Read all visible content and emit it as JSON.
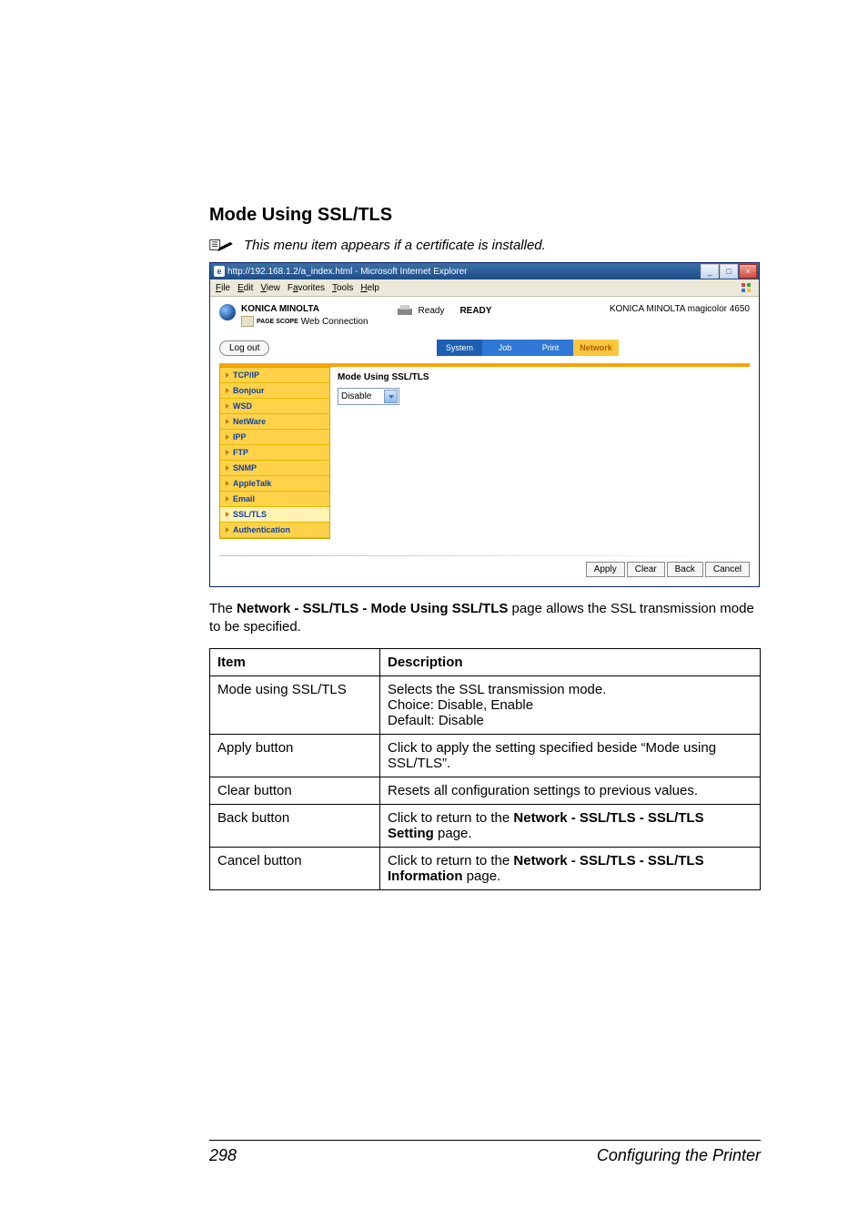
{
  "section_title": "Mode Using SSL/TLS",
  "note_text": "This menu item appears if a certificate is installed.",
  "screenshot": {
    "window_title": "http://192.168.1.2/a_index.html - Microsoft Internet Explorer",
    "menu": {
      "file": "File",
      "edit": "Edit",
      "view": "View",
      "favorites": "Favorites",
      "tools": "Tools",
      "help": "Help"
    },
    "brand": "KONICA MINOLTA",
    "pagescope_prefix": "PAGE SCOPE",
    "webcon": "Web Connection",
    "status_label": "Ready",
    "status_big": "READY",
    "device": "KONICA MINOLTA magicolor 4650",
    "logout": "Log out",
    "tabs": {
      "system": "System",
      "job": "Job",
      "print": "Print",
      "network": "Network"
    },
    "sidebar": [
      "TCP/IP",
      "Bonjour",
      "WSD",
      "NetWare",
      "IPP",
      "FTP",
      "SNMP",
      "AppleTalk",
      "Email",
      "SSL/TLS",
      "Authentication"
    ],
    "sidebar_active_index": 9,
    "content_title": "Mode Using SSL/TLS",
    "dropdown_value": "Disable",
    "buttons": {
      "apply": "Apply",
      "clear": "Clear",
      "back": "Back",
      "cancel": "Cancel"
    }
  },
  "paragraph_pre": "The ",
  "paragraph_bold": "Network - SSL/TLS - Mode Using SSL/TLS",
  "paragraph_post": " page allows the SSL transmission mode to be specified.",
  "table": {
    "head_item": "Item",
    "head_desc": "Description",
    "rows": {
      "r1_item": "Mode using SSL/TLS",
      "r1_desc_l1": "Selects the SSL transmission mode.",
      "r1_desc_l2": "Choice:  Disable, Enable",
      "r1_desc_l3": "Default:  Disable",
      "r2_item": "Apply button",
      "r2_desc": "Click to apply the setting specified beside “Mode using SSL/TLS”.",
      "r3_item": "Clear button",
      "r3_desc": "Resets all configuration settings to previous values.",
      "r4_item": "Back button",
      "r4_desc_pre": "Click to return to the ",
      "r4_desc_bold": "Network - SSL/TLS - SSL/TLS Setting",
      "r4_desc_post": " page.",
      "r5_item": "Cancel button",
      "r5_desc_pre": "Click to return to the ",
      "r5_desc_bold": "Network - SSL/TLS - SSL/TLS Information",
      "r5_desc_post": " page."
    }
  },
  "footer_page": "298",
  "footer_title": "Configuring the Printer"
}
